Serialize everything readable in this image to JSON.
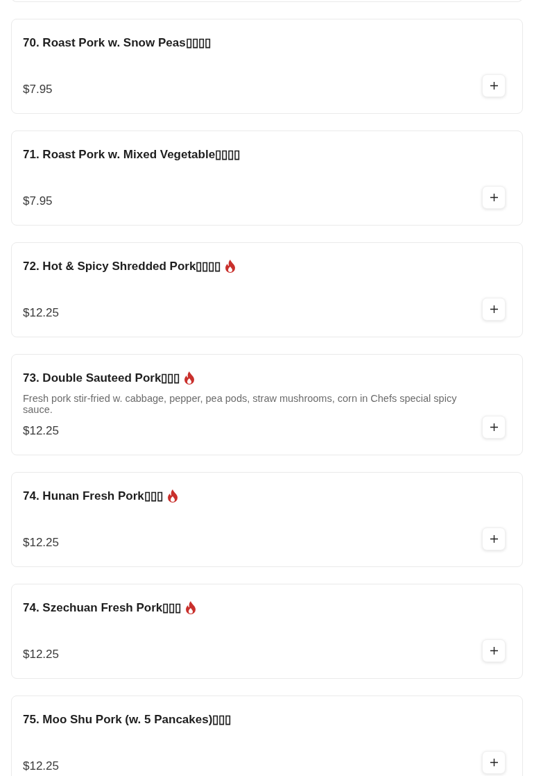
{
  "items": [
    {
      "title": "70. Roast Pork w. Snow Peas▯▯▯▯",
      "spicy": false,
      "price": "$7.95"
    },
    {
      "title": "71. Roast Pork w. Mixed Vegetable▯▯▯▯",
      "spicy": false,
      "price": "$7.95"
    },
    {
      "title": "72. Hot & Spicy Shredded Pork▯▯▯▯",
      "spicy": true,
      "price": "$12.25"
    },
    {
      "title": "73. Double Sauteed Pork▯▯▯",
      "spicy": true,
      "description": "Fresh pork stir-fried w. cabbage, pepper, pea pods, straw mushrooms, corn in Chefs special spicy sauce.",
      "price": "$12.25"
    },
    {
      "title": "74. Hunan Fresh Pork▯▯▯",
      "spicy": true,
      "price": "$12.25"
    },
    {
      "title": "74. Szechuan Fresh Pork▯▯▯",
      "spicy": true,
      "price": "$12.25"
    },
    {
      "title": "75. Moo Shu Pork (w. 5 Pancakes)▯▯▯",
      "spicy": false,
      "price": "$12.25"
    }
  ]
}
